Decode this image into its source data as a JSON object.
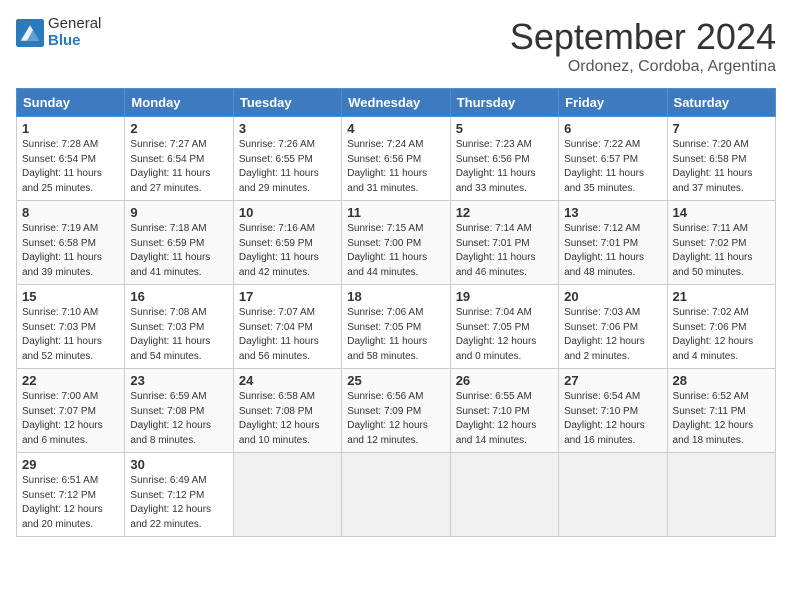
{
  "header": {
    "logo_general": "General",
    "logo_blue": "Blue",
    "month": "September 2024",
    "location": "Ordonez, Cordoba, Argentina"
  },
  "weekdays": [
    "Sunday",
    "Monday",
    "Tuesday",
    "Wednesday",
    "Thursday",
    "Friday",
    "Saturday"
  ],
  "weeks": [
    [
      {
        "day": "1",
        "info": "Sunrise: 7:28 AM\nSunset: 6:54 PM\nDaylight: 11 hours\nand 25 minutes."
      },
      {
        "day": "2",
        "info": "Sunrise: 7:27 AM\nSunset: 6:54 PM\nDaylight: 11 hours\nand 27 minutes."
      },
      {
        "day": "3",
        "info": "Sunrise: 7:26 AM\nSunset: 6:55 PM\nDaylight: 11 hours\nand 29 minutes."
      },
      {
        "day": "4",
        "info": "Sunrise: 7:24 AM\nSunset: 6:56 PM\nDaylight: 11 hours\nand 31 minutes."
      },
      {
        "day": "5",
        "info": "Sunrise: 7:23 AM\nSunset: 6:56 PM\nDaylight: 11 hours\nand 33 minutes."
      },
      {
        "day": "6",
        "info": "Sunrise: 7:22 AM\nSunset: 6:57 PM\nDaylight: 11 hours\nand 35 minutes."
      },
      {
        "day": "7",
        "info": "Sunrise: 7:20 AM\nSunset: 6:58 PM\nDaylight: 11 hours\nand 37 minutes."
      }
    ],
    [
      {
        "day": "8",
        "info": "Sunrise: 7:19 AM\nSunset: 6:58 PM\nDaylight: 11 hours\nand 39 minutes."
      },
      {
        "day": "9",
        "info": "Sunrise: 7:18 AM\nSunset: 6:59 PM\nDaylight: 11 hours\nand 41 minutes."
      },
      {
        "day": "10",
        "info": "Sunrise: 7:16 AM\nSunset: 6:59 PM\nDaylight: 11 hours\nand 42 minutes."
      },
      {
        "day": "11",
        "info": "Sunrise: 7:15 AM\nSunset: 7:00 PM\nDaylight: 11 hours\nand 44 minutes."
      },
      {
        "day": "12",
        "info": "Sunrise: 7:14 AM\nSunset: 7:01 PM\nDaylight: 11 hours\nand 46 minutes."
      },
      {
        "day": "13",
        "info": "Sunrise: 7:12 AM\nSunset: 7:01 PM\nDaylight: 11 hours\nand 48 minutes."
      },
      {
        "day": "14",
        "info": "Sunrise: 7:11 AM\nSunset: 7:02 PM\nDaylight: 11 hours\nand 50 minutes."
      }
    ],
    [
      {
        "day": "15",
        "info": "Sunrise: 7:10 AM\nSunset: 7:03 PM\nDaylight: 11 hours\nand 52 minutes."
      },
      {
        "day": "16",
        "info": "Sunrise: 7:08 AM\nSunset: 7:03 PM\nDaylight: 11 hours\nand 54 minutes."
      },
      {
        "day": "17",
        "info": "Sunrise: 7:07 AM\nSunset: 7:04 PM\nDaylight: 11 hours\nand 56 minutes."
      },
      {
        "day": "18",
        "info": "Sunrise: 7:06 AM\nSunset: 7:05 PM\nDaylight: 11 hours\nand 58 minutes."
      },
      {
        "day": "19",
        "info": "Sunrise: 7:04 AM\nSunset: 7:05 PM\nDaylight: 12 hours\nand 0 minutes."
      },
      {
        "day": "20",
        "info": "Sunrise: 7:03 AM\nSunset: 7:06 PM\nDaylight: 12 hours\nand 2 minutes."
      },
      {
        "day": "21",
        "info": "Sunrise: 7:02 AM\nSunset: 7:06 PM\nDaylight: 12 hours\nand 4 minutes."
      }
    ],
    [
      {
        "day": "22",
        "info": "Sunrise: 7:00 AM\nSunset: 7:07 PM\nDaylight: 12 hours\nand 6 minutes."
      },
      {
        "day": "23",
        "info": "Sunrise: 6:59 AM\nSunset: 7:08 PM\nDaylight: 12 hours\nand 8 minutes."
      },
      {
        "day": "24",
        "info": "Sunrise: 6:58 AM\nSunset: 7:08 PM\nDaylight: 12 hours\nand 10 minutes."
      },
      {
        "day": "25",
        "info": "Sunrise: 6:56 AM\nSunset: 7:09 PM\nDaylight: 12 hours\nand 12 minutes."
      },
      {
        "day": "26",
        "info": "Sunrise: 6:55 AM\nSunset: 7:10 PM\nDaylight: 12 hours\nand 14 minutes."
      },
      {
        "day": "27",
        "info": "Sunrise: 6:54 AM\nSunset: 7:10 PM\nDaylight: 12 hours\nand 16 minutes."
      },
      {
        "day": "28",
        "info": "Sunrise: 6:52 AM\nSunset: 7:11 PM\nDaylight: 12 hours\nand 18 minutes."
      }
    ],
    [
      {
        "day": "29",
        "info": "Sunrise: 6:51 AM\nSunset: 7:12 PM\nDaylight: 12 hours\nand 20 minutes."
      },
      {
        "day": "30",
        "info": "Sunrise: 6:49 AM\nSunset: 7:12 PM\nDaylight: 12 hours\nand 22 minutes."
      },
      {
        "day": "",
        "info": ""
      },
      {
        "day": "",
        "info": ""
      },
      {
        "day": "",
        "info": ""
      },
      {
        "day": "",
        "info": ""
      },
      {
        "day": "",
        "info": ""
      }
    ]
  ]
}
